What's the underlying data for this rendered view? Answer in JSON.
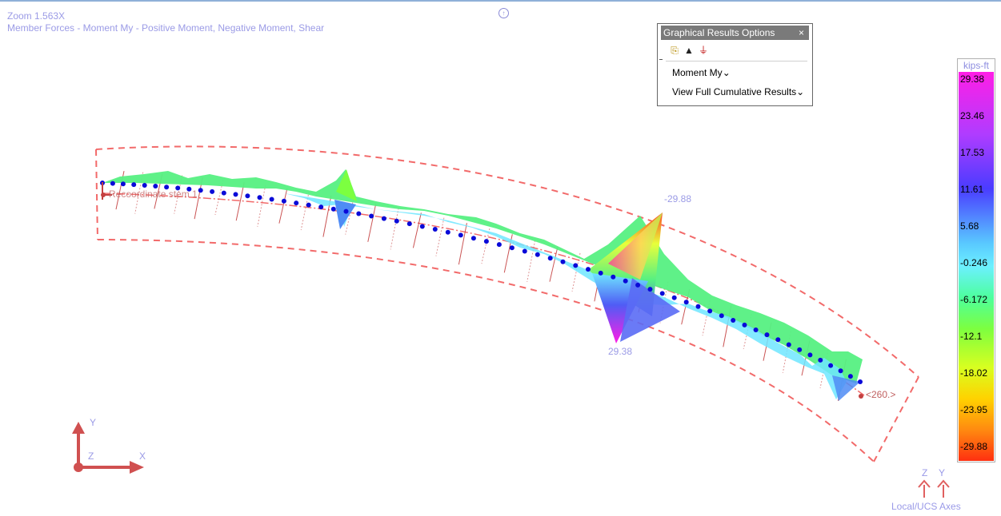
{
  "hud": {
    "zoom": "Zoom  1.563X",
    "result_description": "Member Forces - Moment My - Positive Moment, Negative Moment, Shear"
  },
  "compass_glyph": "↑",
  "graphical_results_options": {
    "title": "Graphical Results Options",
    "close_glyph": "×",
    "tools": [
      {
        "name": "results-settings-icon",
        "glyph": "⎘"
      },
      {
        "name": "warning-triangle-icon",
        "glyph": "▲"
      },
      {
        "name": "member-force-icon",
        "glyph": "⏚"
      }
    ],
    "result_type": "Moment My",
    "cumulative": "View Full Cumulative Results",
    "dropdown_glyph": "⌄"
  },
  "legend": {
    "unit": "kips-ft",
    "ticks": [
      "29.38",
      "23.46",
      "17.53",
      "11.61",
      "5.68",
      "-0.246",
      "-6.172",
      "-12.1",
      "-18.02",
      "-23.95",
      "-29.88"
    ]
  },
  "model_labels": {
    "max_value": "-29.88",
    "min_value": "29.38",
    "member_label": "<260.>",
    "start_label": "Recoordinate stem 1"
  },
  "global_axes": {
    "x": "X",
    "y": "Y",
    "z": "Z"
  },
  "local_axes": {
    "title": "Local/UCS Axes",
    "z": "Z",
    "y": "Y"
  },
  "colors": {
    "hud_text": "#9b9be6",
    "member_dots": "#0a0ad8",
    "boundary_dash": "#f26a6a",
    "hatch": "#c44040",
    "fill_green": "#56f082",
    "fill_cyan": "#6fe6ff",
    "fill_blue": "#4f5cf5",
    "fill_magenta": "#ff1ee6",
    "fill_red": "#ff4422",
    "fill_yellow": "#e8ff3a"
  }
}
